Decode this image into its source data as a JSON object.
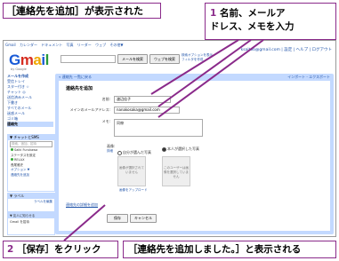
{
  "callouts": {
    "top": "［連絡先を追加］が表示された",
    "step1_num": "1",
    "step1_line1": " 名前、メールア",
    "step1_line2": "ドレス、メモを入力",
    "step2_num": "2",
    "step2_text": "［保存］をクリック",
    "done": "［連絡先を追加しました。］と表示される"
  },
  "screen": {
    "topnav": [
      "Gmail",
      "カレンダー",
      "ドキュメント",
      "写真",
      "リーダー",
      "ウェブ",
      "その他▼"
    ],
    "account": "ksaitoo@gmail.com | 設定 | ヘルプ | ログアウト",
    "logo_letters": [
      "G",
      "m",
      "a",
      "i",
      "l"
    ],
    "logo_sub": "by Google",
    "search_mail_label": "メールを検索",
    "search_web_label": "ウェブを検索",
    "search_links": [
      "検索オプションを表示",
      "フィルタを作成"
    ],
    "leftnav": {
      "compose": "メールを作成",
      "items": [
        "受信トレイ",
        "スター付き ☆",
        "チャット ◎",
        "送信済みメール",
        "下書き",
        "すべてのメール",
        "迷惑メール",
        "ゴミ箱"
      ],
      "contacts": "連絡先"
    },
    "chat": {
      "header": "▼ チャットとSMS",
      "search_placeholder": "検索、追加、招待",
      "me_name": "Saiki Furukawa",
      "me_status": "ステータスを設定",
      "contact1": "RELAX",
      "contact1_status": "長尾雅史",
      "options": "オプション ▼",
      "add": "連絡先を追加"
    },
    "labels": {
      "header": "▼ ラベル",
      "edit": "ラベルを編集"
    },
    "invite": {
      "header": "▼ 友人に知らせる",
      "text": "Gmail を招待"
    },
    "main": {
      "top_left": "« 連絡先 一覧に戻る",
      "top_right": "インポート - エクスポート",
      "form_title": "連絡先を追加",
      "name_label": "名前:",
      "name_value": "渡辺佳子",
      "email_label": "メインのメールアドレス:",
      "email_value": "nanakosaka@gmail.com",
      "note_label": "メモ:",
      "note_value": "同僚",
      "photo_label": "画像:",
      "photo_link": "詳細",
      "radio1": "自分が選んだ写真",
      "radio2": "本人が選択した写真",
      "photo_a_text": "画像が選択されていません",
      "photo_b_text": "このユーザーは画像を選択していません",
      "photo_change": "画像をアップロード",
      "more_fields": "連絡先の詳細を追加",
      "save": "保存",
      "cancel": "キャンセル"
    }
  }
}
